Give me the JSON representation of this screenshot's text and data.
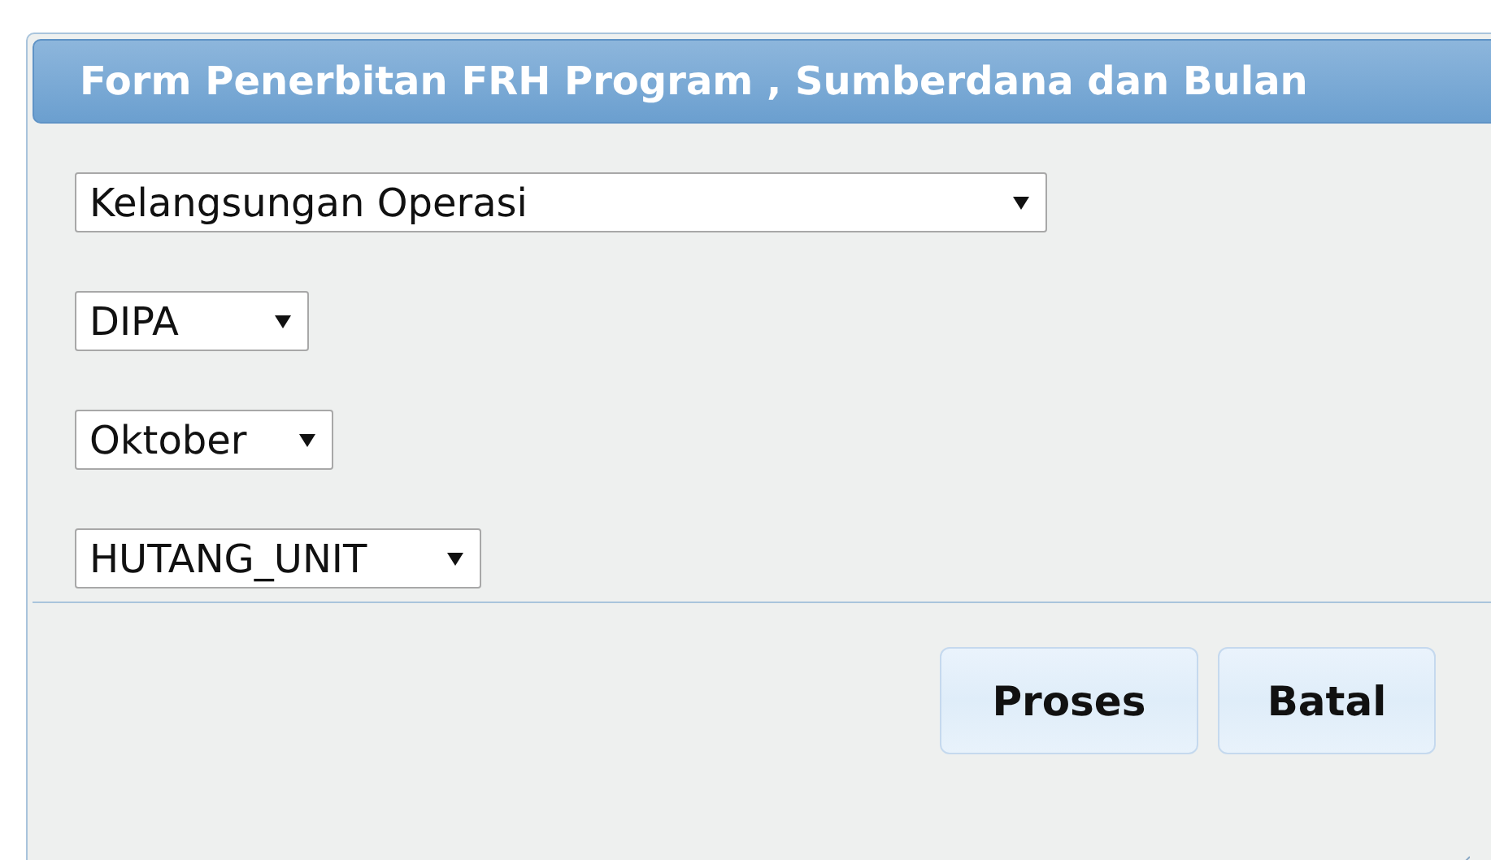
{
  "dialog": {
    "title": "Form Penerbitan FRH Program , Sumberdana dan Bulan",
    "selects": [
      {
        "value": "Kelangsungan Operasi"
      },
      {
        "value": "DIPA"
      },
      {
        "value": "Oktober"
      },
      {
        "value": "HUTANG_UNIT"
      }
    ],
    "buttons": [
      "Proses",
      "Batal"
    ]
  }
}
